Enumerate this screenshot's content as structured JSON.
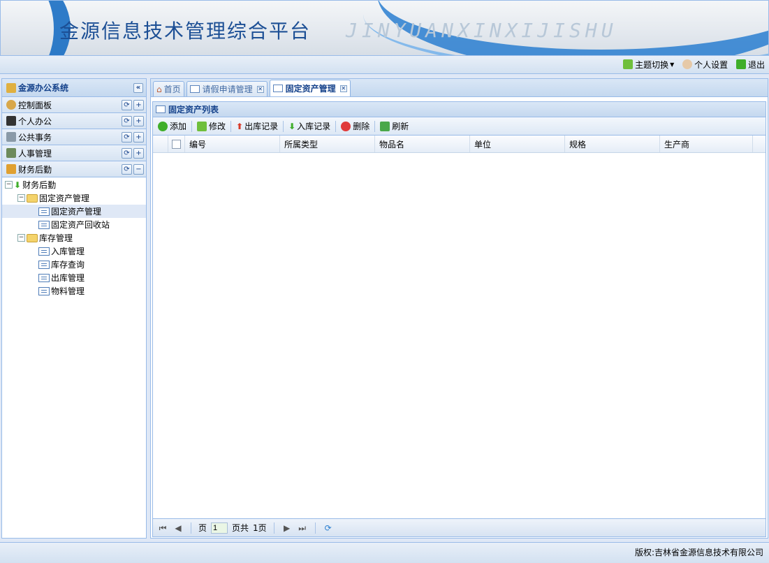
{
  "header": {
    "title": "金源信息技术管理综合平台",
    "pinyin": "JINYUANXINXIJISHU"
  },
  "topbar": {
    "theme": "主题切换",
    "settings": "个人设置",
    "logout": "退出"
  },
  "west": {
    "title": "金源办公系统",
    "sections": [
      "控制面板",
      "个人办公",
      "公共事务",
      "人事管理",
      "财务后勤"
    ],
    "tree": {
      "root": "财务后勤",
      "group1": "固定资产管理",
      "group1_items": [
        "固定资产管理",
        "固定资产回收站"
      ],
      "group2": "库存管理",
      "group2_items": [
        "入库管理",
        "库存查询",
        "出库管理",
        "物料管理"
      ]
    }
  },
  "tabs": [
    "首页",
    "请假申请管理",
    "固定资产管理"
  ],
  "grid": {
    "title": "固定资产列表",
    "toolbar": [
      "添加",
      "修改",
      "出库记录",
      "入库记录",
      "删除",
      "刷新"
    ],
    "columns": [
      "编号",
      "所属类型",
      "物品名",
      "单位",
      "规格",
      "生产商"
    ]
  },
  "pager": {
    "page_label": "页",
    "page_value": "1",
    "total_label": "页共",
    "total_pages": "1页"
  },
  "footer": "版权:吉林省金源信息技术有限公司",
  "colors": {
    "accent": "#15428b",
    "border": "#99bbe8",
    "banner_blue": "#1a6fc4"
  }
}
